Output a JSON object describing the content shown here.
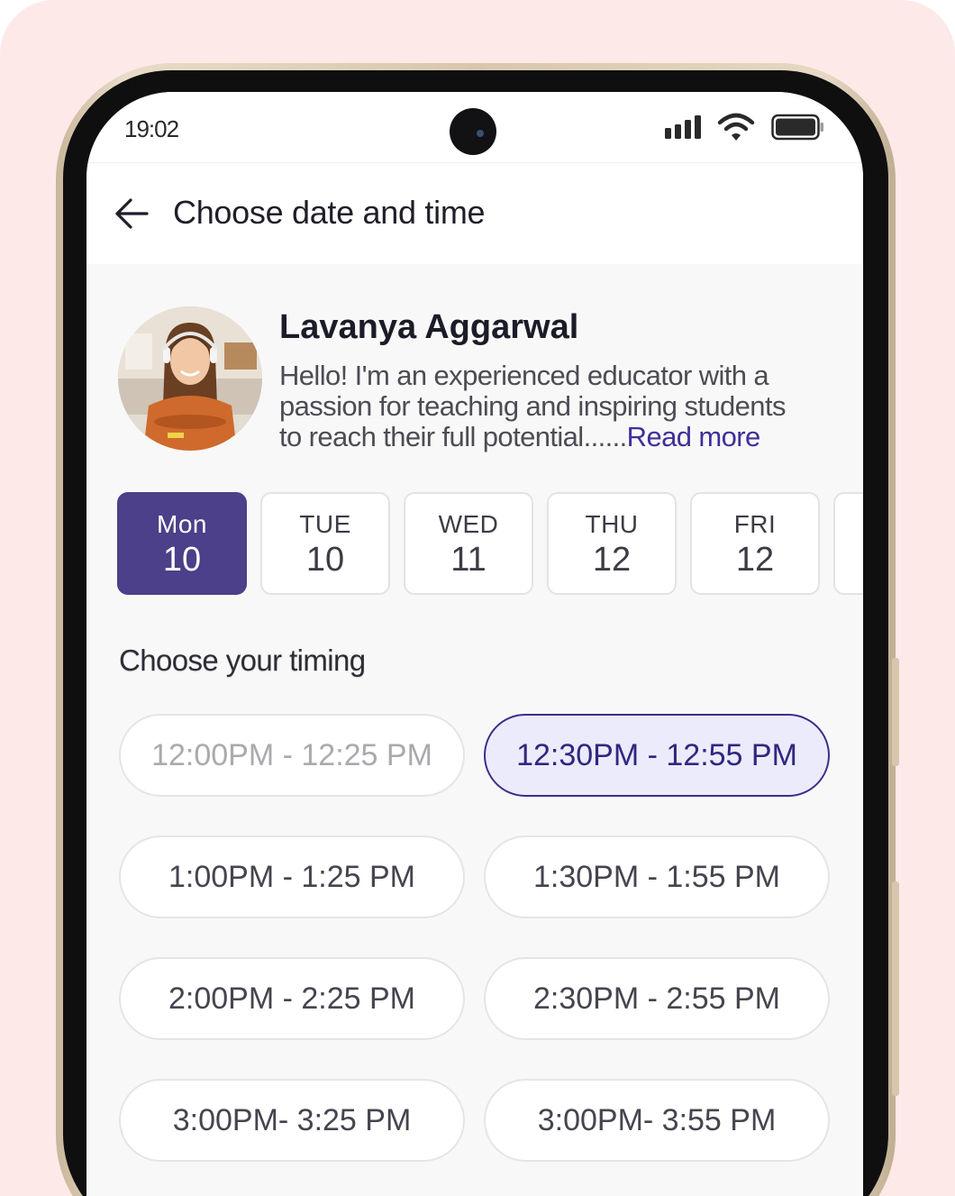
{
  "status_bar": {
    "time": "19:02"
  },
  "header": {
    "title": "Choose date and time"
  },
  "educator": {
    "name": "Lavanya Aggarwal",
    "bio_line1": "Hello! I'm an experienced educator with a",
    "bio_line2": "passion for teaching and inspiring students",
    "bio_line3": "to reach their full potential......",
    "read_more": "Read more"
  },
  "days": [
    {
      "name": "Mon",
      "date": "10",
      "selected": true
    },
    {
      "name": "TUE",
      "date": "10",
      "selected": false
    },
    {
      "name": "WED",
      "date": "11",
      "selected": false
    },
    {
      "name": "THU",
      "date": "12",
      "selected": false
    },
    {
      "name": "FRI",
      "date": "12",
      "selected": false
    }
  ],
  "timing": {
    "heading": "Choose your timing",
    "slots": [
      {
        "label": "12:00PM - 12:25 PM",
        "state": "disabled"
      },
      {
        "label": "12:30PM - 12:55 PM",
        "state": "selected"
      },
      {
        "label": "1:00PM - 1:25 PM",
        "state": "available"
      },
      {
        "label": "1:30PM - 1:55 PM",
        "state": "available"
      },
      {
        "label": "2:00PM - 2:25 PM",
        "state": "available"
      },
      {
        "label": "2:30PM - 2:55 PM",
        "state": "available"
      },
      {
        "label": "3:00PM- 3:25 PM",
        "state": "available"
      },
      {
        "label": "3:00PM- 3:55 PM",
        "state": "available"
      }
    ]
  },
  "colors": {
    "accent": "#4b4089",
    "selected_slot_bg": "#ecebfb",
    "selected_slot_border": "#3a2f8a",
    "background": "#fde9e8"
  }
}
